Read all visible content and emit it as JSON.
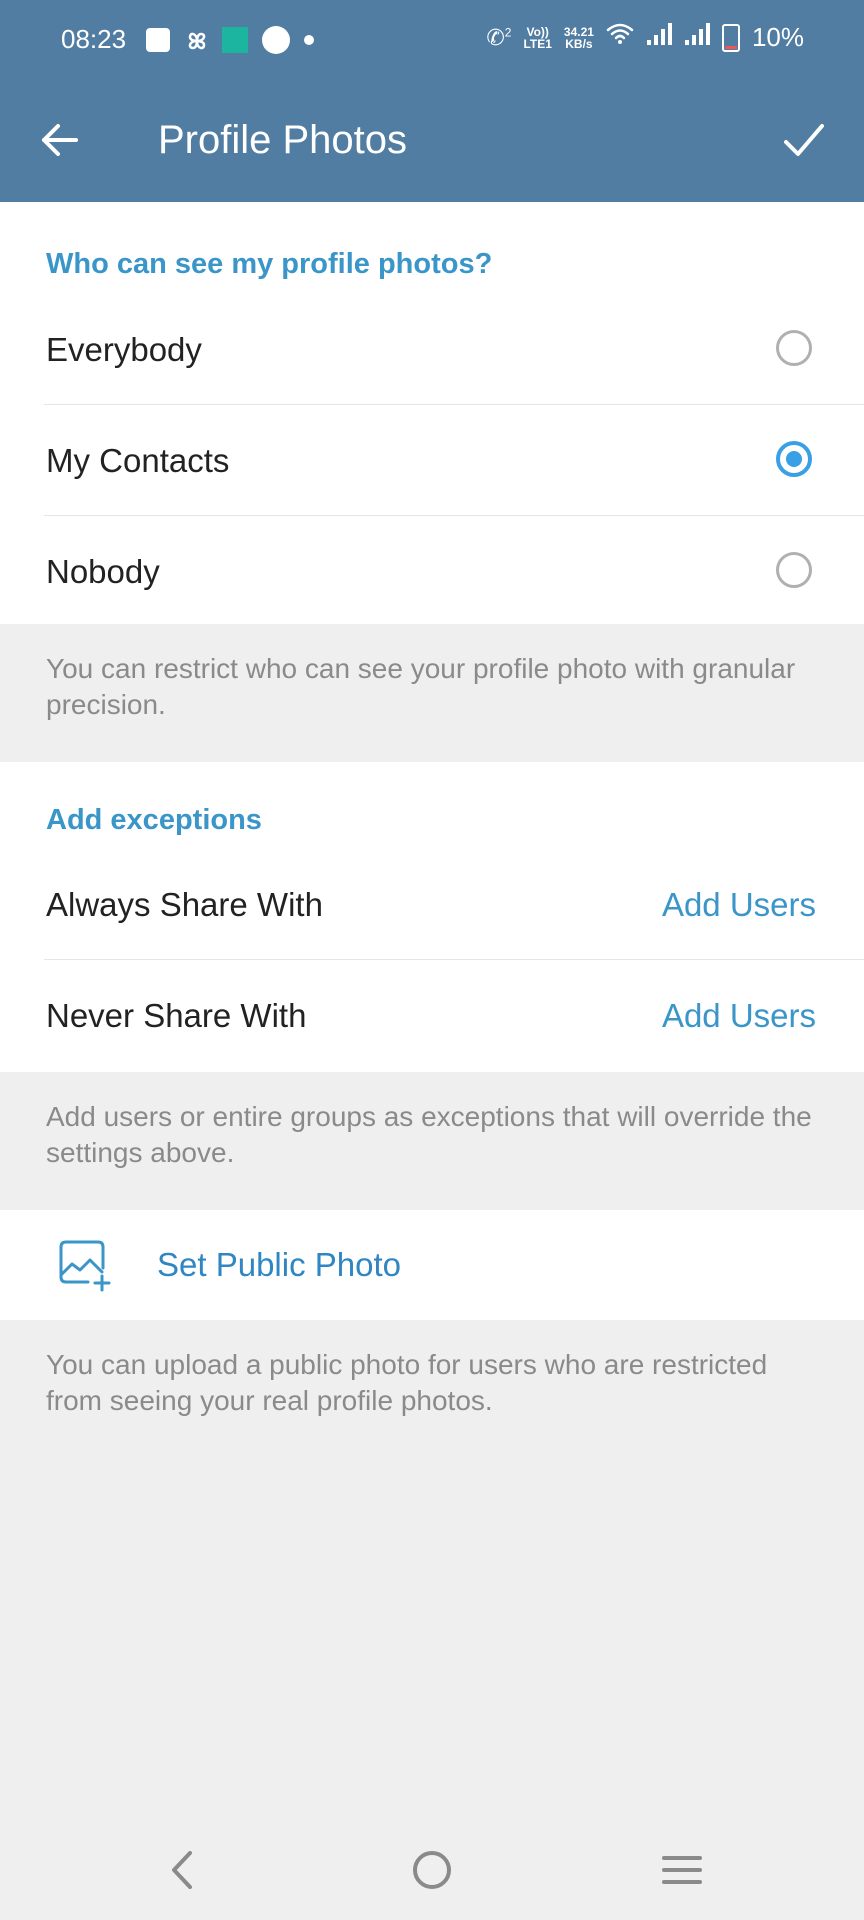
{
  "status_bar": {
    "time": "08:23",
    "call_sim": "2",
    "volte_top": "Vo))",
    "volte_bottom": "LTE1",
    "speed_value": "34.21",
    "speed_unit": "KB/s",
    "battery": "10%"
  },
  "toolbar": {
    "title": "Profile Photos"
  },
  "visibility": {
    "header": "Who can see my profile photos?",
    "options": [
      {
        "label": "Everybody",
        "selected": false
      },
      {
        "label": "My Contacts",
        "selected": true
      },
      {
        "label": "Nobody",
        "selected": false
      }
    ],
    "info": "You can restrict who can see your profile photo with granular precision."
  },
  "exceptions": {
    "header": "Add exceptions",
    "rows": [
      {
        "label": "Always Share With",
        "action": "Add Users"
      },
      {
        "label": "Never Share With",
        "action": "Add Users"
      }
    ],
    "info": "Add users or entire groups as exceptions that will override the settings above."
  },
  "public_photo": {
    "label": "Set Public Photo",
    "info": "You can upload a public photo for users who are restricted from seeing your real profile photos."
  },
  "colors": {
    "toolbar": "#517da2",
    "accent": "#3a95c9",
    "radio_checked": "#3aa0e6"
  }
}
